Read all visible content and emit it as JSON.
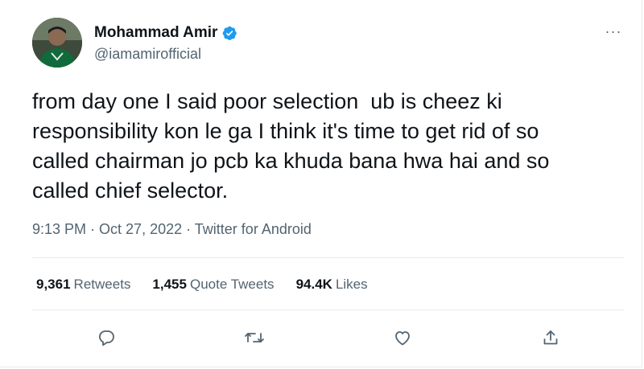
{
  "author": {
    "name": "Mohammad Amir",
    "handle": "@iamamirofficial",
    "verified_icon": "verified-badge-icon",
    "accent_color": "#1d9bf0"
  },
  "more_icon": "more-options-icon",
  "more_label": "···",
  "tweet": {
    "text": "from day one I said poor selection  ub is cheez ki\nresponsibility kon le ga I think it's time to get rid of so\ncalled chairman jo pcb ka khuda bana hwa hai and so\ncalled chief selector."
  },
  "meta": {
    "time": "9:13 PM",
    "sep1": " · ",
    "date": "Oct 27, 2022",
    "sep2": " · ",
    "source": "Twitter for Android"
  },
  "stats": {
    "retweets_count": "9,361",
    "retweets_label": "Retweets",
    "quotes_count": "1,455",
    "quotes_label": "Quote Tweets",
    "likes_count": "94.4K",
    "likes_label": "Likes"
  },
  "actions": [
    {
      "icon": "reply-icon"
    },
    {
      "icon": "retweet-icon"
    },
    {
      "icon": "like-icon"
    },
    {
      "icon": "share-icon"
    }
  ],
  "colors": {
    "text": "#0f1419",
    "secondary": "#536471",
    "border": "#e6ecf0"
  }
}
